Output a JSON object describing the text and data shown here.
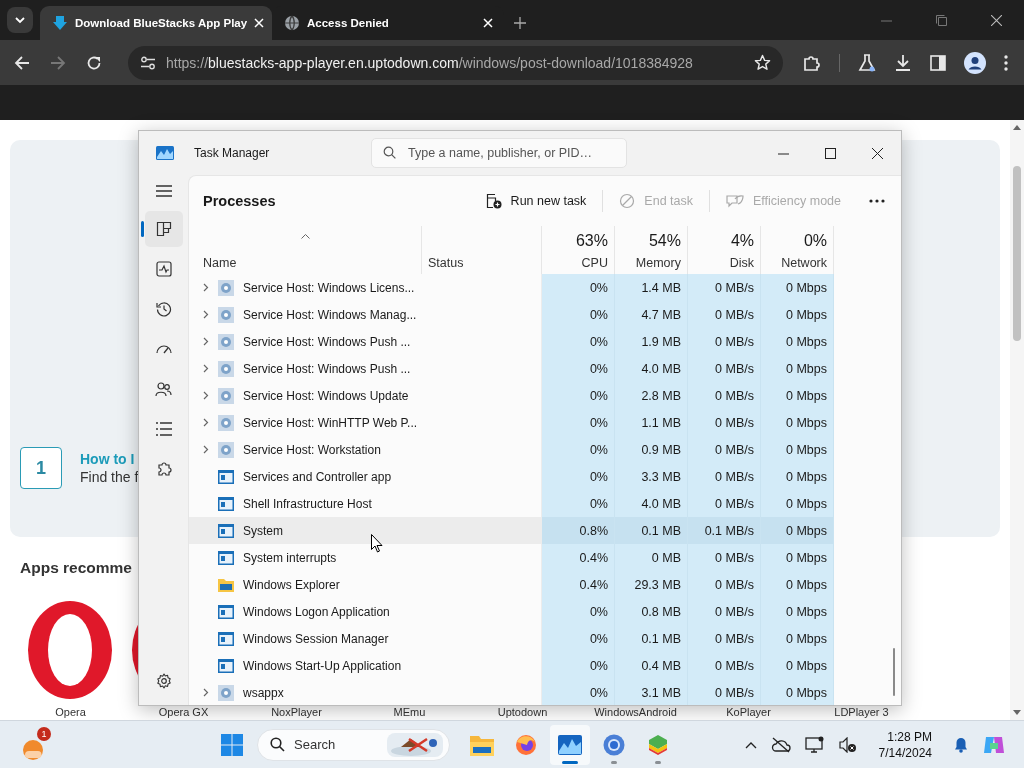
{
  "browser": {
    "tabs": [
      {
        "kind": "download",
        "title": "Download BlueStacks App Play",
        "selected": true
      },
      {
        "kind": "globe",
        "title": "Access Denied",
        "selected": false
      }
    ],
    "forward_disabled": true,
    "url": {
      "scheme": "https://",
      "host": "bluestacks-app-player.en.uptodown.com",
      "path": "/windows/post-download/1018384928"
    }
  },
  "webpage": {
    "step": {
      "number": "1",
      "title": "How to I",
      "text": "Find the f"
    },
    "section_title": "Apps recomme",
    "apps": [
      {
        "name": "Opera"
      },
      {
        "name": "Opera GX"
      },
      {
        "name": "NoxPlayer"
      },
      {
        "name": "MEmu"
      },
      {
        "name": "Uptodown"
      },
      {
        "name": "WindowsAndroid"
      },
      {
        "name": "KoPlayer"
      },
      {
        "name": "LDPlayer 3"
      }
    ]
  },
  "task_manager": {
    "title": "Task Manager",
    "search": {
      "placeholder": "Type a name, publisher, or PID…"
    },
    "nav": [
      {
        "kind": "processes",
        "selected": true
      },
      {
        "kind": "performance",
        "selected": false
      },
      {
        "kind": "app-history",
        "selected": false
      },
      {
        "kind": "startup",
        "selected": false
      },
      {
        "kind": "users",
        "selected": false
      },
      {
        "kind": "details",
        "selected": false
      },
      {
        "kind": "services",
        "selected": false
      }
    ],
    "page_title": "Processes",
    "actions": [
      {
        "kind": "run",
        "label": "Run new task",
        "disabled": false
      },
      {
        "kind": "end",
        "label": "End task",
        "disabled": true
      },
      {
        "kind": "efficiency",
        "label": "Efficiency mode",
        "disabled": true
      }
    ],
    "columns": [
      {
        "label": "Name",
        "sorted": true
      },
      {
        "label": "Status",
        "sorted": false
      },
      {
        "label": "CPU",
        "usage": "63%",
        "sorted": false
      },
      {
        "label": "Memory",
        "usage": "54%",
        "sorted": false
      },
      {
        "label": "Disk",
        "usage": "4%",
        "sorted": false
      },
      {
        "label": "Network",
        "usage": "0%",
        "sorted": false
      }
    ],
    "rows": [
      {
        "name": "Service Host: Windows Licens...",
        "expandable": true,
        "kind": "service",
        "cpu": "0%",
        "memory": "1.4 MB",
        "disk": "0 MB/s",
        "network": "0 Mbps",
        "selected": false
      },
      {
        "name": "Service Host: Windows Manag...",
        "expandable": true,
        "kind": "service",
        "cpu": "0%",
        "memory": "4.7 MB",
        "disk": "0 MB/s",
        "network": "0 Mbps",
        "selected": false
      },
      {
        "name": "Service Host: Windows Push ...",
        "expandable": true,
        "kind": "service",
        "cpu": "0%",
        "memory": "1.9 MB",
        "disk": "0 MB/s",
        "network": "0 Mbps",
        "selected": false
      },
      {
        "name": "Service Host: Windows Push ...",
        "expandable": true,
        "kind": "service",
        "cpu": "0%",
        "memory": "4.0 MB",
        "disk": "0 MB/s",
        "network": "0 Mbps",
        "selected": false
      },
      {
        "name": "Service Host: Windows Update",
        "expandable": true,
        "kind": "service",
        "cpu": "0%",
        "memory": "2.8 MB",
        "disk": "0 MB/s",
        "network": "0 Mbps",
        "selected": false
      },
      {
        "name": "Service Host: WinHTTP Web P...",
        "expandable": true,
        "kind": "service",
        "cpu": "0%",
        "memory": "1.1 MB",
        "disk": "0 MB/s",
        "network": "0 Mbps",
        "selected": false
      },
      {
        "name": "Service Host: Workstation",
        "expandable": true,
        "kind": "service",
        "cpu": "0%",
        "memory": "0.9 MB",
        "disk": "0 MB/s",
        "network": "0 Mbps",
        "selected": false
      },
      {
        "name": "Services and Controller app",
        "expandable": false,
        "kind": "app",
        "cpu": "0%",
        "memory": "3.3 MB",
        "disk": "0 MB/s",
        "network": "0 Mbps",
        "selected": false
      },
      {
        "name": "Shell Infrastructure Host",
        "expandable": false,
        "kind": "app",
        "cpu": "0%",
        "memory": "4.0 MB",
        "disk": "0 MB/s",
        "network": "0 Mbps",
        "selected": false
      },
      {
        "name": "System",
        "expandable": false,
        "kind": "app",
        "cpu": "0.8%",
        "memory": "0.1 MB",
        "disk": "0.1 MB/s",
        "network": "0 Mbps",
        "selected": true
      },
      {
        "name": "System interrupts",
        "expandable": false,
        "kind": "app",
        "cpu": "0.4%",
        "memory": "0 MB",
        "disk": "0 MB/s",
        "network": "0 Mbps",
        "selected": false
      },
      {
        "name": "Windows Explorer",
        "expandable": false,
        "kind": "folder",
        "cpu": "0.4%",
        "memory": "29.3 MB",
        "disk": "0 MB/s",
        "network": "0 Mbps",
        "selected": false
      },
      {
        "name": "Windows Logon Application",
        "expandable": false,
        "kind": "app",
        "cpu": "0%",
        "memory": "0.8 MB",
        "disk": "0 MB/s",
        "network": "0 Mbps",
        "selected": false
      },
      {
        "name": "Windows Session Manager",
        "expandable": false,
        "kind": "app",
        "cpu": "0%",
        "memory": "0.1 MB",
        "disk": "0 MB/s",
        "network": "0 Mbps",
        "selected": false
      },
      {
        "name": "Windows Start-Up Application",
        "expandable": false,
        "kind": "app",
        "cpu": "0%",
        "memory": "0.4 MB",
        "disk": "0 MB/s",
        "network": "0 Mbps",
        "selected": false
      },
      {
        "name": "wsappx",
        "expandable": true,
        "kind": "service",
        "cpu": "0%",
        "memory": "3.1 MB",
        "disk": "0 MB/s",
        "network": "0 Mbps",
        "selected": false
      }
    ]
  },
  "taskbar": {
    "weather_badge": "1",
    "search_placeholder": "Search",
    "apps": [
      {
        "kind": "explorer",
        "running": false,
        "active": false
      },
      {
        "kind": "firefox",
        "running": false,
        "active": false
      },
      {
        "kind": "task-manager",
        "running": true,
        "active": true
      },
      {
        "kind": "chrome",
        "running": true,
        "active": false
      },
      {
        "kind": "bluestacks",
        "running": true,
        "active": false
      }
    ],
    "time": "1:28 PM",
    "date": "7/14/2024"
  }
}
